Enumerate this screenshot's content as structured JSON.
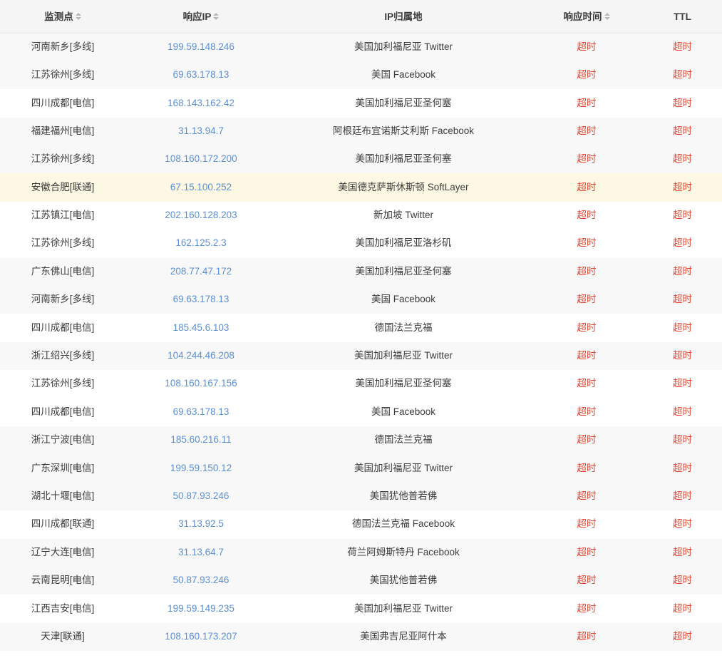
{
  "table": {
    "columns": [
      {
        "key": "node",
        "label": "监测点",
        "sortable": true,
        "sort_icon": "sort-updown-icon"
      },
      {
        "key": "ip",
        "label": "响应IP",
        "sortable": true,
        "sort_icon": "sort-updown-icon"
      },
      {
        "key": "location",
        "label": "IP归属地",
        "sortable": false,
        "sort_icon": null
      },
      {
        "key": "rt",
        "label": "响应时间",
        "sortable": true,
        "sort_icon": "sort-updown-icon"
      },
      {
        "key": "ttl",
        "label": "TTL",
        "sortable": false,
        "sort_icon": null
      }
    ],
    "colors": {
      "header_bg": "#f5f5f5",
      "row_gray": "#f8f8f9",
      "row_white": "#ffffff",
      "row_highlight": "#fcf8e3",
      "link": "#5b8fd4",
      "timeout_text": "#e8442e",
      "body_text": "#3c3c3c"
    },
    "rows": [
      {
        "node": "河南新乡[多线]",
        "ip": "199.59.148.246",
        "location": "美国加利福尼亚 Twitter",
        "rt": "超时",
        "ttl": "超时",
        "stripe": "gray"
      },
      {
        "node": "江苏徐州[多线]",
        "ip": "69.63.178.13",
        "location": "美国 Facebook",
        "rt": "超时",
        "ttl": "超时",
        "stripe": "gray"
      },
      {
        "node": "四川成都[电信]",
        "ip": "168.143.162.42",
        "location": "美国加利福尼亚圣何塞",
        "rt": "超时",
        "ttl": "超时",
        "stripe": "white"
      },
      {
        "node": "福建福州[电信]",
        "ip": "31.13.94.7",
        "location": "阿根廷布宜诺斯艾利斯 Facebook",
        "rt": "超时",
        "ttl": "超时",
        "stripe": "gray"
      },
      {
        "node": "江苏徐州[多线]",
        "ip": "108.160.172.200",
        "location": "美国加利福尼亚圣何塞",
        "rt": "超时",
        "ttl": "超时",
        "stripe": "gray"
      },
      {
        "node": "安徽合肥[联通]",
        "ip": "67.15.100.252",
        "location": "美国德克萨斯休斯顿 SoftLayer",
        "rt": "超时",
        "ttl": "超时",
        "stripe": "highlight"
      },
      {
        "node": "江苏镇江[电信]",
        "ip": "202.160.128.203",
        "location": "新加坡 Twitter",
        "rt": "超时",
        "ttl": "超时",
        "stripe": "white"
      },
      {
        "node": "江苏徐州[多线]",
        "ip": "162.125.2.3",
        "location": "美国加利福尼亚洛杉矶",
        "rt": "超时",
        "ttl": "超时",
        "stripe": "white"
      },
      {
        "node": "广东佛山[电信]",
        "ip": "208.77.47.172",
        "location": "美国加利福尼亚圣何塞",
        "rt": "超时",
        "ttl": "超时",
        "stripe": "gray"
      },
      {
        "node": "河南新乡[多线]",
        "ip": "69.63.178.13",
        "location": "美国 Facebook",
        "rt": "超时",
        "ttl": "超时",
        "stripe": "gray"
      },
      {
        "node": "四川成都[电信]",
        "ip": "185.45.6.103",
        "location": "德国法兰克福",
        "rt": "超时",
        "ttl": "超时",
        "stripe": "white"
      },
      {
        "node": "浙江绍兴[多线]",
        "ip": "104.244.46.208",
        "location": "美国加利福尼亚 Twitter",
        "rt": "超时",
        "ttl": "超时",
        "stripe": "gray"
      },
      {
        "node": "江苏徐州[多线]",
        "ip": "108.160.167.156",
        "location": "美国加利福尼亚圣何塞",
        "rt": "超时",
        "ttl": "超时",
        "stripe": "white"
      },
      {
        "node": "四川成都[电信]",
        "ip": "69.63.178.13",
        "location": "美国 Facebook",
        "rt": "超时",
        "ttl": "超时",
        "stripe": "white"
      },
      {
        "node": "浙江宁波[电信]",
        "ip": "185.60.216.11",
        "location": "德国法兰克福",
        "rt": "超时",
        "ttl": "超时",
        "stripe": "gray"
      },
      {
        "node": "广东深圳[电信]",
        "ip": "199.59.150.12",
        "location": "美国加利福尼亚 Twitter",
        "rt": "超时",
        "ttl": "超时",
        "stripe": "gray"
      },
      {
        "node": "湖北十堰[电信]",
        "ip": "50.87.93.246",
        "location": "美国犹他普若佛",
        "rt": "超时",
        "ttl": "超时",
        "stripe": "gray"
      },
      {
        "node": "四川成都[联通]",
        "ip": "31.13.92.5",
        "location": "德国法兰克福 Facebook",
        "rt": "超时",
        "ttl": "超时",
        "stripe": "white"
      },
      {
        "node": "辽宁大连[电信]",
        "ip": "31.13.64.7",
        "location": "荷兰阿姆斯特丹 Facebook",
        "rt": "超时",
        "ttl": "超时",
        "stripe": "gray"
      },
      {
        "node": "云南昆明[电信]",
        "ip": "50.87.93.246",
        "location": "美国犹他普若佛",
        "rt": "超时",
        "ttl": "超时",
        "stripe": "gray"
      },
      {
        "node": "江西吉安[电信]",
        "ip": "199.59.149.235",
        "location": "美国加利福尼亚 Twitter",
        "rt": "超时",
        "ttl": "超时",
        "stripe": "white"
      },
      {
        "node": "天津[联通]",
        "ip": "108.160.173.207",
        "location": "美国弗吉尼亚阿什本",
        "rt": "超时",
        "ttl": "超时",
        "stripe": "gray"
      }
    ]
  }
}
